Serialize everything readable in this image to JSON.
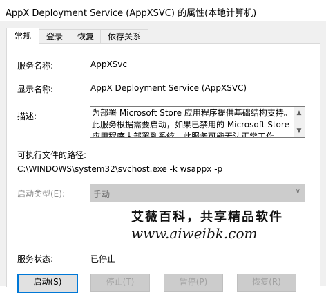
{
  "window": {
    "title": "AppX Deployment Service (AppXSVC) 的属性(本地计算机)"
  },
  "tabs": [
    {
      "label": "常规",
      "active": true
    },
    {
      "label": "登录",
      "active": false
    },
    {
      "label": "恢复",
      "active": false
    },
    {
      "label": "依存关系",
      "active": false
    }
  ],
  "general": {
    "service_name_label": "服务名称:",
    "service_name_value": "AppXSvc",
    "display_name_label": "显示名称:",
    "display_name_value": "AppX Deployment Service (AppXSVC)",
    "description_label": "描述:",
    "description_value": "为部署 Microsoft Store 应用程序提供基础结构支持。此服务根据需要启动，如果已禁用的 Microsoft Store 应用程序未部署到系统，此服务可能无法正常工作。",
    "exe_path_label": "可执行文件的路径:",
    "exe_path_value": "C:\\WINDOWS\\system32\\svchost.exe -k wsappx -p",
    "startup_type_label": "启动类型(E):",
    "startup_type_value": "手动",
    "status_label": "服务状态:",
    "status_value": "已停止"
  },
  "watermark": {
    "line1": "艾薇百科，共享精品软件",
    "line2": "www.aiweibk.com"
  },
  "buttons": {
    "start": "启动(S)",
    "stop": "停止(T)",
    "pause": "暂停(P)",
    "resume": "恢复(R)"
  },
  "icons": {
    "scroll_up": "scroll-up-arrow-icon",
    "scroll_down": "scroll-down-arrow-icon",
    "dropdown": "chevron-down-icon"
  }
}
